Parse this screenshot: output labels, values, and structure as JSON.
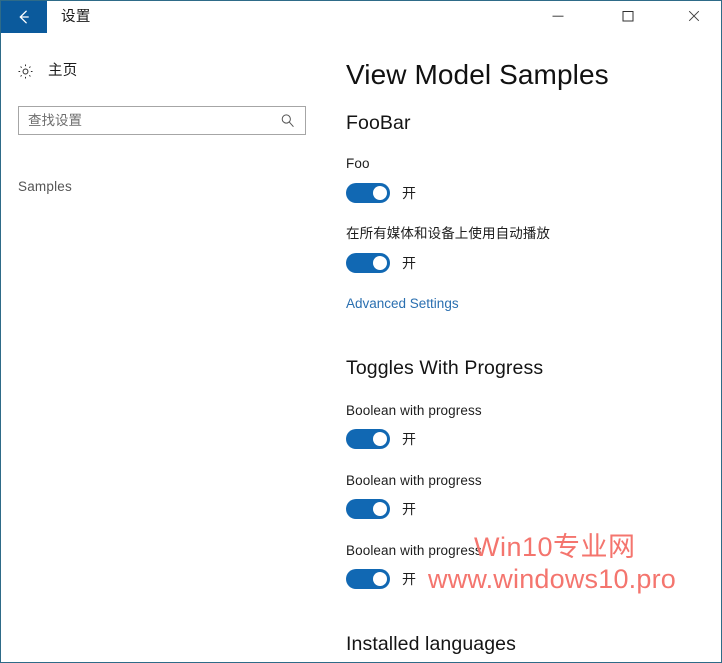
{
  "window": {
    "title": "设置",
    "back_icon": "back-arrow-icon",
    "controls": {
      "minimize": "minimize-icon",
      "maximize": "maximize-icon",
      "close": "close-icon"
    },
    "border_color": "#2e6b88",
    "back_button_color": "#0b5a9c"
  },
  "sidebar": {
    "home": {
      "icon": "gear-icon",
      "label": "主页"
    },
    "search": {
      "placeholder": "查找设置",
      "value": "",
      "icon": "search-icon"
    },
    "items": [
      {
        "label": "Samples",
        "selected": false
      }
    ]
  },
  "main": {
    "title": "View Model Samples",
    "accent_color": "#1168b3",
    "link_color": "#2a6fb0",
    "sections": [
      {
        "heading": "FooBar",
        "settings": [
          {
            "label": "Foo",
            "toggle": {
              "state_label": "开",
              "on": true
            }
          },
          {
            "label": "在所有媒体和设备上使用自动播放",
            "toggle": {
              "state_label": "开",
              "on": true
            }
          }
        ],
        "link": "Advanced Settings"
      },
      {
        "heading": "Toggles With Progress",
        "settings": [
          {
            "label": "Boolean with progress",
            "toggle": {
              "state_label": "开",
              "on": true
            }
          },
          {
            "label": "Boolean with progress",
            "toggle": {
              "state_label": "开",
              "on": true
            }
          },
          {
            "label": "Boolean with progress",
            "toggle": {
              "state_label": "开",
              "on": true
            }
          }
        ]
      },
      {
        "heading": "Installed languages",
        "settings": []
      }
    ]
  },
  "watermark": {
    "line1": "Win10专业网",
    "line2": "www.windows10.pro",
    "color": "#f4756e"
  }
}
